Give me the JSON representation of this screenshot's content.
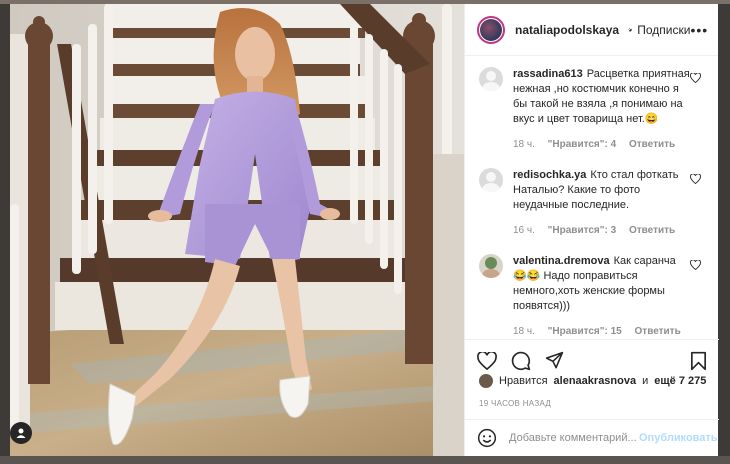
{
  "post": {
    "username": "nataliapodolskaya",
    "follow_label": "Подписки",
    "dot": "•",
    "more": "•••"
  },
  "comments": [
    {
      "user": "rassadina613",
      "text": "Расцветка приятная нежная ,но костюмчик конечно я бы такой не взяла ,я понимаю на вкус и цвет товарища нет.😄",
      "time": "18 ч.",
      "likes": "\"Нравится\": 4",
      "reply": "Ответить"
    },
    {
      "user": "redisochka.ya",
      "text": "Кто стал фоткать Наталью? Какие то фото неудачные последние.",
      "time": "16 ч.",
      "likes": "\"Нравится\": 3",
      "reply": "Ответить"
    },
    {
      "user": "valentina.dremova",
      "text": "Как саранча 😂😂 Надо поправиться немного,хоть женские формы появятся)))",
      "time": "18 ч.",
      "likes": "\"Нравится\": 15",
      "reply": "Ответить"
    }
  ],
  "likes_line": {
    "prefix": "Нравится",
    "user": "alenaakrasnova",
    "conj": "и",
    "rest": "ещё 7 275"
  },
  "timestamp": "19 ЧАСОВ НАЗАД",
  "composer": {
    "placeholder": "Добавьте комментарий...",
    "publish": "Опубликовать"
  },
  "icons": {
    "heart": "heart-icon",
    "comment": "comment-icon",
    "share": "share-icon",
    "save": "bookmark-icon",
    "emoji": "emoji-icon",
    "user_tag": "user-tag-icon"
  },
  "colors": {
    "verified": "#3897f0",
    "publish_disabled": "#b3dbff",
    "suit": "#b39ddb"
  }
}
